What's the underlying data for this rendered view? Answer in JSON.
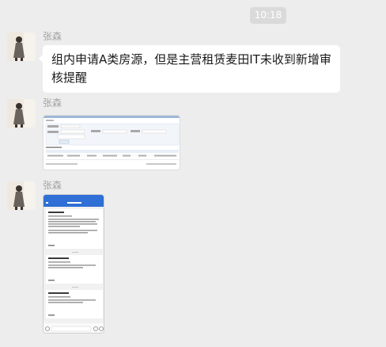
{
  "chat": {
    "timestamp": "10:18",
    "messages": [
      {
        "sender": "张森",
        "type": "text",
        "text": "组内申请A类房源，但是主营租赁麦田IT未收到新增审核提醒"
      },
      {
        "sender": "张森",
        "type": "image",
        "image_kind": "desktop-screenshot"
      },
      {
        "sender": "张森",
        "type": "image",
        "image_kind": "phone-screenshot"
      }
    ]
  },
  "colors": {
    "background": "#ededed",
    "bubble": "#ffffff",
    "timestamp_pill": "#dadada",
    "sender_name": "#a3a3a3",
    "phone_header": "#2f6fd6"
  }
}
